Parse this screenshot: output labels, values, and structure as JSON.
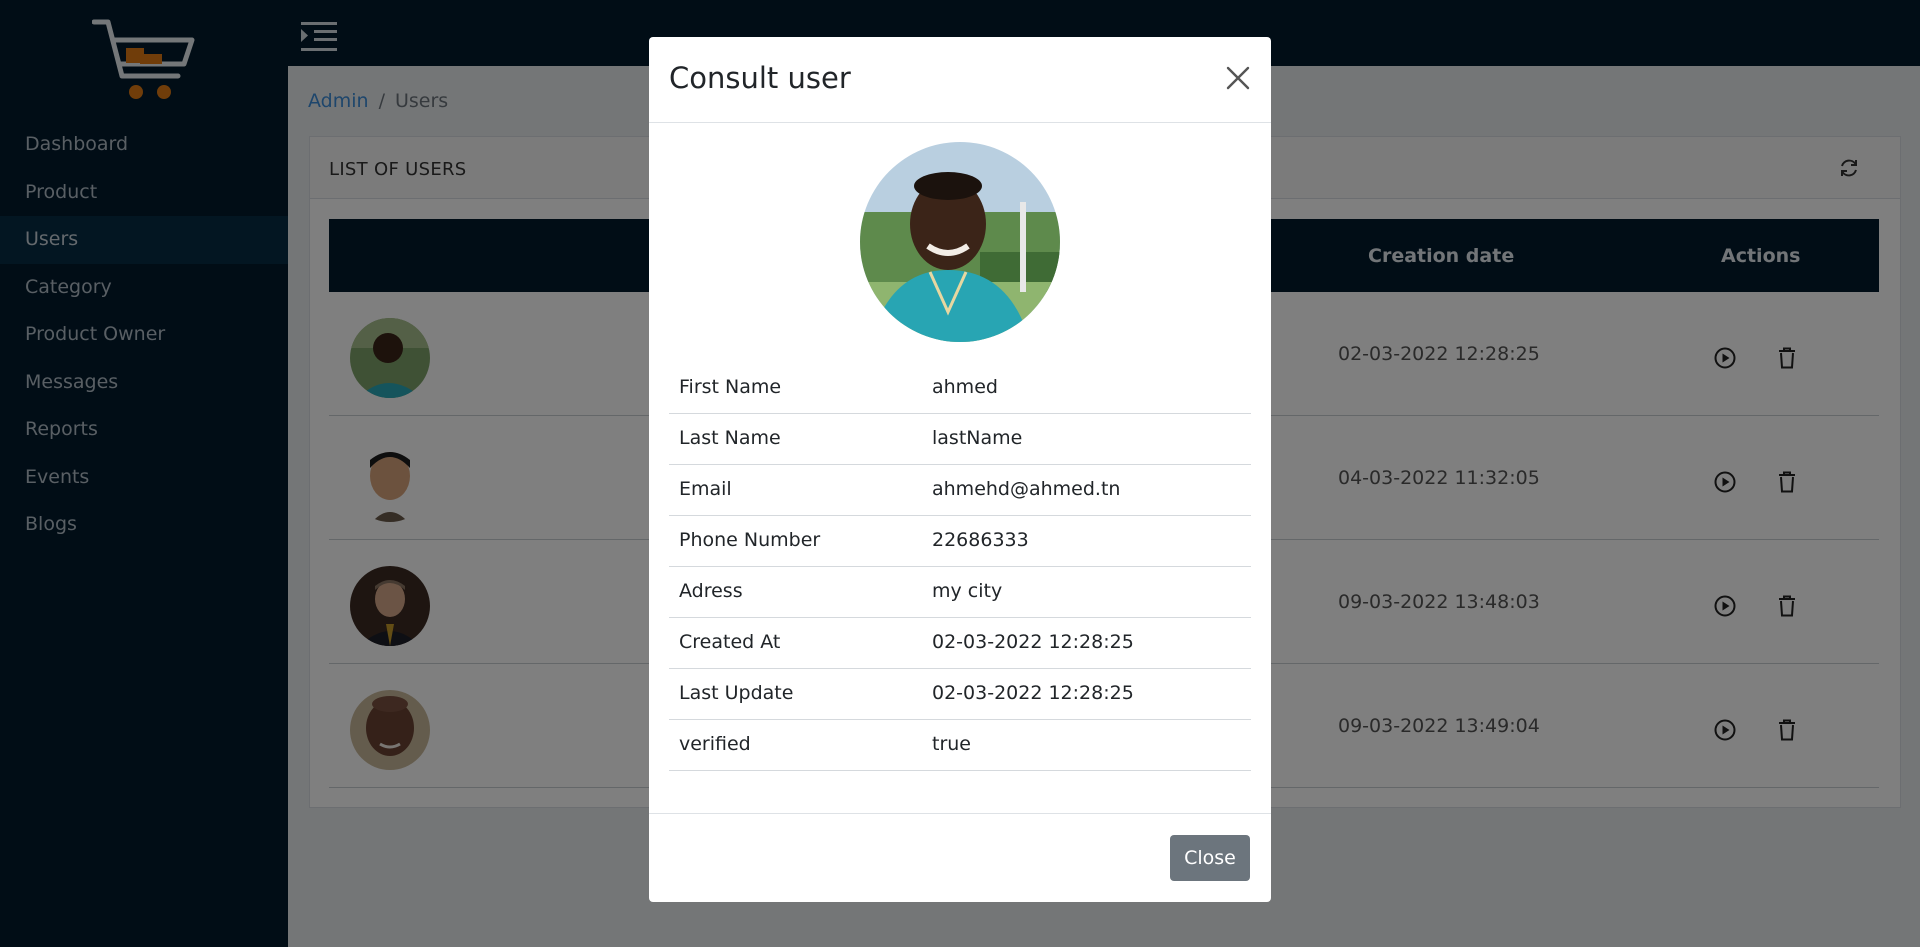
{
  "sidebar": {
    "items": [
      {
        "label": "Dashboard"
      },
      {
        "label": "Product"
      },
      {
        "label": "Users"
      },
      {
        "label": "Category"
      },
      {
        "label": "Product Owner"
      },
      {
        "label": "Messages"
      },
      {
        "label": "Reports"
      },
      {
        "label": "Events"
      },
      {
        "label": "Blogs"
      }
    ],
    "active_item": "Users"
  },
  "breadcrumb": {
    "root": "Admin",
    "separator": "/",
    "current": "Users"
  },
  "card": {
    "title": "LIST OF USERS"
  },
  "table": {
    "columns": {
      "creation_date": "Creation date",
      "actions": "Actions"
    },
    "rows": [
      {
        "creation_date": "02-03-2022 12:28:25"
      },
      {
        "creation_date": "04-03-2022 11:32:05"
      },
      {
        "creation_date": "09-03-2022 13:48:03"
      },
      {
        "creation_date": "09-03-2022 13:49:04"
      }
    ]
  },
  "modal": {
    "title": "Consult user",
    "fields": [
      {
        "label": "First Name",
        "value": "ahmed"
      },
      {
        "label": "Last Name",
        "value": "lastName"
      },
      {
        "label": "Email",
        "value": "ahmehd@ahmed.tn"
      },
      {
        "label": "Phone Number",
        "value": "22686333"
      },
      {
        "label": "Adress",
        "value": "my city"
      },
      {
        "label": "Created At",
        "value": "02-03-2022 12:28:25"
      },
      {
        "label": "Last Update",
        "value": "02-03-2022 12:28:25"
      },
      {
        "label": "verified",
        "value": "true"
      }
    ],
    "close_label": "Close"
  },
  "colors": {
    "sidebar_bg": "#021b2d",
    "link": "#3c8dd8",
    "accent_orange": "#e07b14",
    "close_button": "#6c757d"
  },
  "icons": [
    "cart-logo-icon",
    "menu-toggle-icon",
    "refresh-icon",
    "play-icon",
    "trash-icon",
    "close-icon"
  ]
}
